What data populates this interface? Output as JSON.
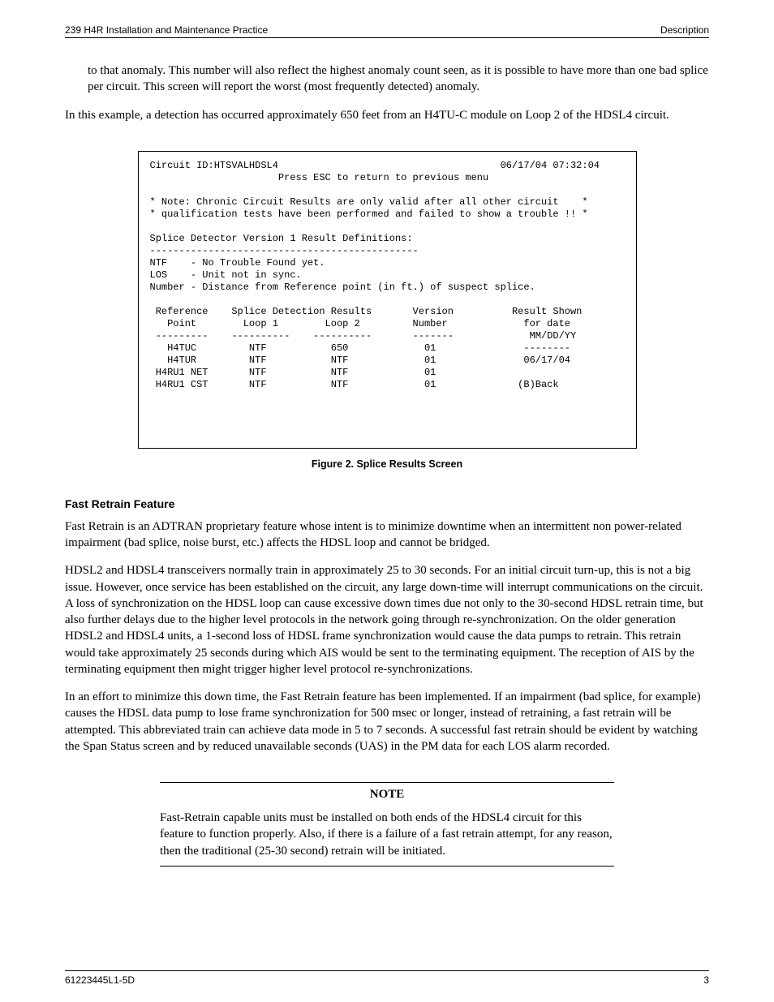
{
  "header": {
    "left": "239 H4R Installation and Maintenance Practice",
    "right": "Description"
  },
  "para1": "to that anomaly. This number will also reflect the highest anomaly count seen, as it is possible to have more than one bad splice per circuit. This screen will report the worst (most frequently detected) anomaly.",
  "para2": "In this example, a detection has occurred approximately 650 feet from an H4TU-C module on Loop 2 of the HDSL4 circuit.",
  "terminal": "Circuit ID:HTSVALHDSL4                                      06/17/04 07:32:04\n                      Press ESC to return to previous menu\n\n* Note: Chronic Circuit Results are only valid after all other circuit    *\n* qualification tests have been performed and failed to show a trouble !! *\n\nSplice Detector Version 1 Result Definitions:\n----------------------------------------------\nNTF    - No Trouble Found yet.\nLOS    - Unit not in sync.\nNumber - Distance from Reference point (in ft.) of suspect splice.\n\n Reference    Splice Detection Results       Version          Result Shown\n   Point        Loop 1        Loop 2         Number             for date\n ---------    ----------    ----------       -------             MM/DD/YY\n   H4TUC         NTF           650             01               --------\n   H4TUR         NTF           NTF             01               06/17/04\n H4RU1 NET       NTF           NTF             01\n H4RU1 CST       NTF           NTF             01              (B)Back\n\n\n\n\n",
  "figure_caption": "Figure 2.  Splice Results Screen",
  "section_head": "Fast Retrain Feature",
  "para3": "Fast Retrain is an ADTRAN proprietary feature whose intent is to minimize downtime when an intermittent non power-related impairment (bad splice, noise burst, etc.) affects the HDSL loop and cannot be bridged.",
  "para4": "HDSL2 and HDSL4 transceivers normally train in approximately 25 to 30 seconds. For an initial circuit turn-up, this is not a big issue. However, once service has been established on the circuit, any large down-time will interrupt communications on the circuit. A loss of synchronization on the HDSL loop can cause excessive down times due not only to the 30-second HDSL retrain time, but also further delays due to the higher level protocols in the network going through re-synchronization. On the older generation HDSL2 and HDSL4 units, a 1-second loss of HDSL frame synchronization would cause the data pumps to retrain. This retrain would take approximately 25 seconds during which AIS would be sent to the terminating equipment. The reception of AIS by the terminating equipment then might trigger higher level protocol re-synchronizations.",
  "para5": "In an effort to minimize this down time, the Fast Retrain feature has been implemented. If an impairment (bad splice, for example) causes the HDSL data pump to lose frame synchronization for 500 msec or longer, instead of retraining, a fast retrain will be attempted. This abbreviated train can achieve data mode in 5 to 7 seconds. A successful fast retrain should be evident by watching the Span Status screen and by reduced unavailable seconds (UAS) in the PM data for each LOS alarm recorded.",
  "note": {
    "title": "NOTE",
    "body": "Fast-Retrain capable units must be installed on both ends of the HDSL4 circuit for this feature to function properly. Also, if there is a failure of a fast retrain attempt, for any reason, then the traditional (25-30 second) retrain will be initiated."
  },
  "footer": {
    "left": "61223445L1-5D",
    "right": "3"
  }
}
